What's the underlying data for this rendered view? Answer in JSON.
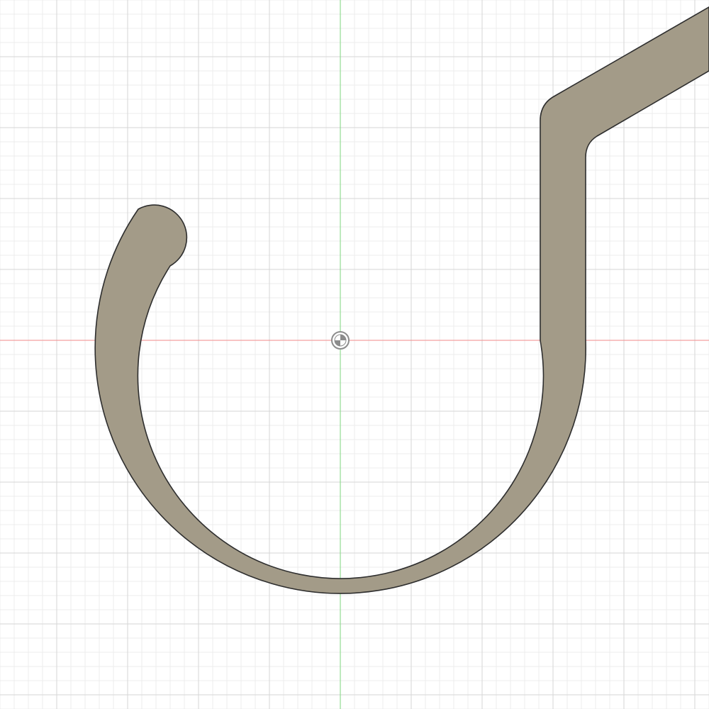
{
  "canvas": {
    "background": "#ffffff",
    "grid_minor_color": "#ececec",
    "grid_major_color": "#d6d6d6",
    "x_axis_color": "#f08a8a",
    "y_axis_color": "#7ed67e"
  },
  "sketch": {
    "shape": "hook-profile",
    "fill_color": "#a39b88",
    "stroke_color": "#2e2e2e"
  },
  "origin_marker": {
    "icon": "origin-icon",
    "color": "#8c8c8c"
  }
}
